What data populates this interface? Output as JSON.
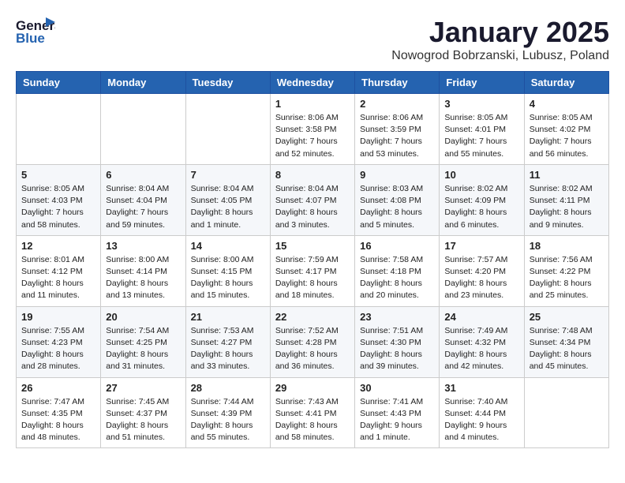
{
  "header": {
    "logo_general": "General",
    "logo_blue": "Blue",
    "title": "January 2025",
    "subtitle": "Nowogrod Bobrzanski, Lubusz, Poland"
  },
  "weekdays": [
    "Sunday",
    "Monday",
    "Tuesday",
    "Wednesday",
    "Thursday",
    "Friday",
    "Saturday"
  ],
  "weeks": [
    [
      {
        "day": "",
        "info": ""
      },
      {
        "day": "",
        "info": ""
      },
      {
        "day": "",
        "info": ""
      },
      {
        "day": "1",
        "info": "Sunrise: 8:06 AM\nSunset: 3:58 PM\nDaylight: 7 hours\nand 52 minutes."
      },
      {
        "day": "2",
        "info": "Sunrise: 8:06 AM\nSunset: 3:59 PM\nDaylight: 7 hours\nand 53 minutes."
      },
      {
        "day": "3",
        "info": "Sunrise: 8:05 AM\nSunset: 4:01 PM\nDaylight: 7 hours\nand 55 minutes."
      },
      {
        "day": "4",
        "info": "Sunrise: 8:05 AM\nSunset: 4:02 PM\nDaylight: 7 hours\nand 56 minutes."
      }
    ],
    [
      {
        "day": "5",
        "info": "Sunrise: 8:05 AM\nSunset: 4:03 PM\nDaylight: 7 hours\nand 58 minutes."
      },
      {
        "day": "6",
        "info": "Sunrise: 8:04 AM\nSunset: 4:04 PM\nDaylight: 7 hours\nand 59 minutes."
      },
      {
        "day": "7",
        "info": "Sunrise: 8:04 AM\nSunset: 4:05 PM\nDaylight: 8 hours\nand 1 minute."
      },
      {
        "day": "8",
        "info": "Sunrise: 8:04 AM\nSunset: 4:07 PM\nDaylight: 8 hours\nand 3 minutes."
      },
      {
        "day": "9",
        "info": "Sunrise: 8:03 AM\nSunset: 4:08 PM\nDaylight: 8 hours\nand 5 minutes."
      },
      {
        "day": "10",
        "info": "Sunrise: 8:02 AM\nSunset: 4:09 PM\nDaylight: 8 hours\nand 6 minutes."
      },
      {
        "day": "11",
        "info": "Sunrise: 8:02 AM\nSunset: 4:11 PM\nDaylight: 8 hours\nand 9 minutes."
      }
    ],
    [
      {
        "day": "12",
        "info": "Sunrise: 8:01 AM\nSunset: 4:12 PM\nDaylight: 8 hours\nand 11 minutes."
      },
      {
        "day": "13",
        "info": "Sunrise: 8:00 AM\nSunset: 4:14 PM\nDaylight: 8 hours\nand 13 minutes."
      },
      {
        "day": "14",
        "info": "Sunrise: 8:00 AM\nSunset: 4:15 PM\nDaylight: 8 hours\nand 15 minutes."
      },
      {
        "day": "15",
        "info": "Sunrise: 7:59 AM\nSunset: 4:17 PM\nDaylight: 8 hours\nand 18 minutes."
      },
      {
        "day": "16",
        "info": "Sunrise: 7:58 AM\nSunset: 4:18 PM\nDaylight: 8 hours\nand 20 minutes."
      },
      {
        "day": "17",
        "info": "Sunrise: 7:57 AM\nSunset: 4:20 PM\nDaylight: 8 hours\nand 23 minutes."
      },
      {
        "day": "18",
        "info": "Sunrise: 7:56 AM\nSunset: 4:22 PM\nDaylight: 8 hours\nand 25 minutes."
      }
    ],
    [
      {
        "day": "19",
        "info": "Sunrise: 7:55 AM\nSunset: 4:23 PM\nDaylight: 8 hours\nand 28 minutes."
      },
      {
        "day": "20",
        "info": "Sunrise: 7:54 AM\nSunset: 4:25 PM\nDaylight: 8 hours\nand 31 minutes."
      },
      {
        "day": "21",
        "info": "Sunrise: 7:53 AM\nSunset: 4:27 PM\nDaylight: 8 hours\nand 33 minutes."
      },
      {
        "day": "22",
        "info": "Sunrise: 7:52 AM\nSunset: 4:28 PM\nDaylight: 8 hours\nand 36 minutes."
      },
      {
        "day": "23",
        "info": "Sunrise: 7:51 AM\nSunset: 4:30 PM\nDaylight: 8 hours\nand 39 minutes."
      },
      {
        "day": "24",
        "info": "Sunrise: 7:49 AM\nSunset: 4:32 PM\nDaylight: 8 hours\nand 42 minutes."
      },
      {
        "day": "25",
        "info": "Sunrise: 7:48 AM\nSunset: 4:34 PM\nDaylight: 8 hours\nand 45 minutes."
      }
    ],
    [
      {
        "day": "26",
        "info": "Sunrise: 7:47 AM\nSunset: 4:35 PM\nDaylight: 8 hours\nand 48 minutes."
      },
      {
        "day": "27",
        "info": "Sunrise: 7:45 AM\nSunset: 4:37 PM\nDaylight: 8 hours\nand 51 minutes."
      },
      {
        "day": "28",
        "info": "Sunrise: 7:44 AM\nSunset: 4:39 PM\nDaylight: 8 hours\nand 55 minutes."
      },
      {
        "day": "29",
        "info": "Sunrise: 7:43 AM\nSunset: 4:41 PM\nDaylight: 8 hours\nand 58 minutes."
      },
      {
        "day": "30",
        "info": "Sunrise: 7:41 AM\nSunset: 4:43 PM\nDaylight: 9 hours\nand 1 minute."
      },
      {
        "day": "31",
        "info": "Sunrise: 7:40 AM\nSunset: 4:44 PM\nDaylight: 9 hours\nand 4 minutes."
      },
      {
        "day": "",
        "info": ""
      }
    ]
  ]
}
